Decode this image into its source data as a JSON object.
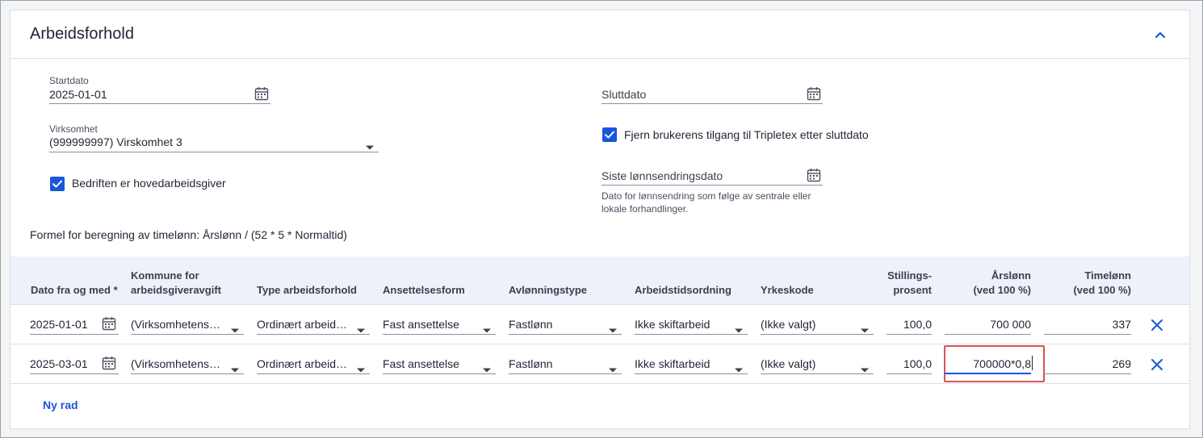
{
  "card": {
    "title": "Arbeidsforhold",
    "collapse_icon": "chevron-up-icon"
  },
  "form": {
    "startdato": {
      "label": "Startdato",
      "value": "2025-01-01"
    },
    "sluttdato": {
      "placeholder": "Sluttdato",
      "value": ""
    },
    "virksomhet": {
      "label": "Virksomhet",
      "value": "(999999997) Virskomhet 3"
    },
    "fjern_tilgang": {
      "label": "Fjern brukerens tilgang til Tripletex etter sluttdato",
      "checked": true
    },
    "hovedarbeidsgiver": {
      "label": "Bedriften er hovedarbeidsgiver",
      "checked": true
    },
    "siste_lonnsendring": {
      "placeholder": "Siste lønnsendringsdato",
      "help": "Dato for lønnsendring som følge av sentrale eller lokale forhandlinger."
    },
    "formula": "Formel for beregning av timelønn: Årslønn / (52 * 5 * Normaltid)"
  },
  "table": {
    "headers": {
      "dato": "Dato fra og med *",
      "kommune_1": "Kommune for",
      "kommune_2": "arbeidsgiveravgift",
      "type": "Type arbeidsforhold",
      "ansettelsesform": "Ansettelsesform",
      "avlonningstype": "Avlønningstype",
      "arbeidstid": "Arbeidstidsordning",
      "yrkeskode": "Yrkeskode",
      "stilling_1": "Stillings-",
      "stilling_2": "prosent",
      "arslonn_1": "Årslønn",
      "arslonn_2": "(ved 100 %)",
      "timelonn_1": "Timelønn",
      "timelonn_2": "(ved 100 %)"
    },
    "rows": [
      {
        "dato": "2025-01-01",
        "kommune": "(Virksomhetens…",
        "type": "Ordinært arbeid…",
        "ansettelsesform": "Fast ansettelse",
        "avlonningstype": "Fastlønn",
        "arbeidstid": "Ikke skiftarbeid",
        "yrkeskode": "(Ikke valgt)",
        "stilling": "100,0",
        "arslonn": "700 000",
        "timelonn": "337"
      },
      {
        "dato": "2025-03-01",
        "kommune": "(Virksomhetens…",
        "type": "Ordinært arbeid…",
        "ansettelsesform": "Fast ansettelse",
        "avlonningstype": "Fastlønn",
        "arbeidstid": "Ikke skiftarbeid",
        "yrkeskode": "(Ikke valgt)",
        "stilling": "100,0",
        "arslonn": "700000*0,8",
        "timelonn": "269"
      }
    ],
    "add_row_label": "Ny rad"
  },
  "colors": {
    "accent": "#1a56db",
    "focus_outline": "#d9534f",
    "table_header_bg": "#eef1f9"
  }
}
